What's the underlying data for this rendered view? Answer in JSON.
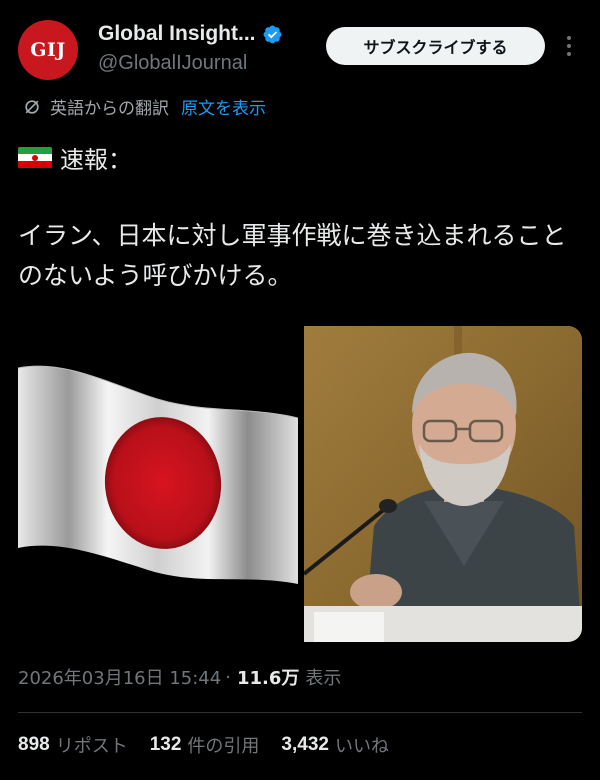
{
  "author": {
    "avatar_text": "GIJ",
    "display_name": "Global Insight...",
    "handle": "@GlobalIJournal",
    "verified": true
  },
  "actions": {
    "subscribe_label": "サブスクライブする"
  },
  "translation": {
    "label": "英語からの翻訳",
    "show_original": "原文を表示"
  },
  "tweet": {
    "headline": "速報：",
    "body": "イラン、日本に対し軍事作戦に巻き込まれることのないよう呼びかける。",
    "flag_icon": "iran-flag"
  },
  "meta": {
    "timestamp": "2026年03月16日 15:44",
    "separator": "·",
    "views_count": "11.6万",
    "views_label": "表示"
  },
  "stats": [
    {
      "count": "898",
      "label": "リポスト"
    },
    {
      "count": "132",
      "label": "件の引用"
    },
    {
      "count": "3,432",
      "label": "いいね"
    }
  ],
  "colors": {
    "background": "#000000",
    "text_primary": "#e7e9ea",
    "text_secondary": "#71767b",
    "accent": "#1d9bf0",
    "avatar_bg": "#c8171e"
  }
}
